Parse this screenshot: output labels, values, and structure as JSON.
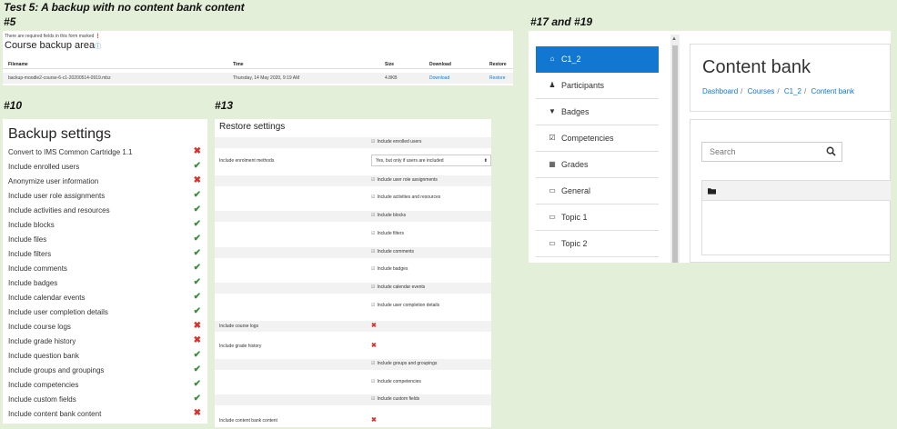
{
  "heading": "Test 5: A backup with no content bank content",
  "captions": {
    "c5": "#5",
    "c10": "#10",
    "c13": "#13",
    "c17": "#17 and #19"
  },
  "p5": {
    "required_note": "There are required fields in this form marked",
    "title": "Course backup area",
    "headers": [
      "Filename",
      "Time",
      "Size",
      "Download",
      "Restore"
    ],
    "row": {
      "filename": "backup-moodle2-course-6-c1-20200514-0919.mbz",
      "time": "Thursday, 14 May 2020, 9:19 AM",
      "size": "4.8KB",
      "download": "Download",
      "restore": "Restore"
    }
  },
  "p10": {
    "title": "Backup settings",
    "items": [
      {
        "label": "Convert to IMS Common Cartridge 1.1",
        "status": "no"
      },
      {
        "label": "Include enrolled users",
        "status": "yes"
      },
      {
        "label": "Anonymize user information",
        "status": "no"
      },
      {
        "label": "Include user role assignments",
        "status": "yes"
      },
      {
        "label": "Include activities and resources",
        "status": "yes"
      },
      {
        "label": "Include blocks",
        "status": "yes"
      },
      {
        "label": "Include files",
        "status": "yes"
      },
      {
        "label": "Include filters",
        "status": "yes"
      },
      {
        "label": "Include comments",
        "status": "yes"
      },
      {
        "label": "Include badges",
        "status": "yes"
      },
      {
        "label": "Include calendar events",
        "status": "yes"
      },
      {
        "label": "Include user completion details",
        "status": "yes"
      },
      {
        "label": "Include course logs",
        "status": "no"
      },
      {
        "label": "Include grade history",
        "status": "no"
      },
      {
        "label": "Include question bank",
        "status": "yes"
      },
      {
        "label": "Include groups and groupings",
        "status": "yes"
      },
      {
        "label": "Include competencies",
        "status": "yes"
      },
      {
        "label": "Include custom fields",
        "status": "yes"
      },
      {
        "label": "Include content bank content",
        "status": "no"
      }
    ]
  },
  "p13": {
    "title": "Restore settings",
    "rows": [
      {
        "label": "",
        "value": "Include enrolled users",
        "kind": "check",
        "shade": true
      },
      {
        "label": "Include enrolment methods",
        "value": "Yes, but only if users are included",
        "kind": "select",
        "shade": false
      },
      {
        "label": "",
        "value": "Include user role assignments",
        "kind": "check",
        "shade": true
      },
      {
        "label": "",
        "value": "Include activities and resources",
        "kind": "check",
        "shade": false
      },
      {
        "label": "",
        "value": "Include blocks",
        "kind": "check",
        "shade": true
      },
      {
        "label": "",
        "value": "Include filters",
        "kind": "check",
        "shade": false
      },
      {
        "label": "",
        "value": "Include comments",
        "kind": "check",
        "shade": true
      },
      {
        "label": "",
        "value": "Include badges",
        "kind": "check",
        "shade": false
      },
      {
        "label": "",
        "value": "Include calendar events",
        "kind": "check",
        "shade": true
      },
      {
        "label": "",
        "value": "Include user completion details",
        "kind": "check",
        "shade": false
      },
      {
        "label": "Include course logs",
        "value": "",
        "kind": "cross",
        "shade": true
      },
      {
        "label": "Include grade history",
        "value": "",
        "kind": "cross",
        "shade": false
      },
      {
        "label": "",
        "value": "Include groups and groupings",
        "kind": "check",
        "shade": true
      },
      {
        "label": "",
        "value": "Include competencies",
        "kind": "check",
        "shade": false
      },
      {
        "label": "",
        "value": "Include custom fields",
        "kind": "check",
        "shade": true
      },
      {
        "label": "Include content bank content",
        "value": "",
        "kind": "cross",
        "shade": false
      }
    ]
  },
  "p17": {
    "nav": [
      {
        "label": "C1_2",
        "icon": "graduation-cap-icon",
        "active": true
      },
      {
        "label": "Participants",
        "icon": "users-icon",
        "active": false
      },
      {
        "label": "Badges",
        "icon": "shield-icon",
        "active": false
      },
      {
        "label": "Competencies",
        "icon": "checkbox-icon",
        "active": false
      },
      {
        "label": "Grades",
        "icon": "table-icon",
        "active": false
      },
      {
        "label": "General",
        "icon": "folder-icon",
        "active": false
      },
      {
        "label": "Topic 1",
        "icon": "folder-icon",
        "active": false
      },
      {
        "label": "Topic 2",
        "icon": "folder-icon",
        "active": false
      }
    ],
    "title": "Content bank",
    "breadcrumb": [
      "Dashboard",
      "Courses",
      "C1_2",
      "Content bank"
    ],
    "search_placeholder": "Search"
  }
}
